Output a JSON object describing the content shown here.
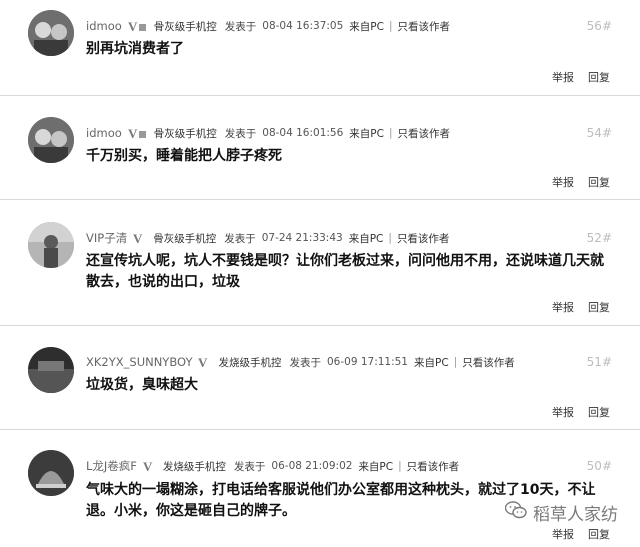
{
  "posts": [
    {
      "username": "idmoo",
      "level": "骨灰级手机控",
      "posted_label": "发表于",
      "timestamp": "08-04 16:37:05",
      "source": "来自PC",
      "only_author": "只看该作者",
      "floor": "56#",
      "content": "别再坑消费者了",
      "report": "举报",
      "reply": "回复"
    },
    {
      "username": "idmoo",
      "level": "骨灰级手机控",
      "posted_label": "发表于",
      "timestamp": "08-04 16:01:56",
      "source": "来自PC",
      "only_author": "只看该作者",
      "floor": "54#",
      "content": "千万别买，睡着能把人脖子疼死",
      "report": "举报",
      "reply": "回复"
    },
    {
      "username": "VIP子清",
      "level": "骨灰级手机控",
      "posted_label": "发表于",
      "timestamp": "07-24 21:33:43",
      "source": "来自PC",
      "only_author": "只看该作者",
      "floor": "52#",
      "content_line1": "还宣传坑人呢，坑人不要钱是呗？让你们老板过来，问问他用不用，还说味道几天就",
      "content_line2": "散去，也说的出口，垃圾",
      "report": "举报",
      "reply": "回复"
    },
    {
      "username": "XK2YX_SUNNYBOY",
      "level": "发烧级手机控",
      "posted_label": "发表于",
      "timestamp": "06-09 17:11:51",
      "source": "来自PC",
      "only_author": "只看该作者",
      "floor": "51#",
      "content": "垃圾货，臭味超大",
      "report": "举报",
      "reply": "回复"
    },
    {
      "username": "L龙J卷疯F",
      "level": "发烧级手机控",
      "posted_label": "发表于",
      "timestamp": "06-08 21:09:02",
      "source": "来自PC",
      "only_author": "只看该作者",
      "floor": "50#",
      "content_line1": "气味大的一塌糊涂，打电话给客服说他们办公室都用这种枕头，就过了10天，不让",
      "content_line2": "退。小米，你这是砸自己的牌子。",
      "report": "举报",
      "reply": "回复"
    }
  ],
  "watermark": "稻草人家纺",
  "icons": {
    "verified": "v-verified-icon",
    "watermark": "wechat-icon"
  }
}
